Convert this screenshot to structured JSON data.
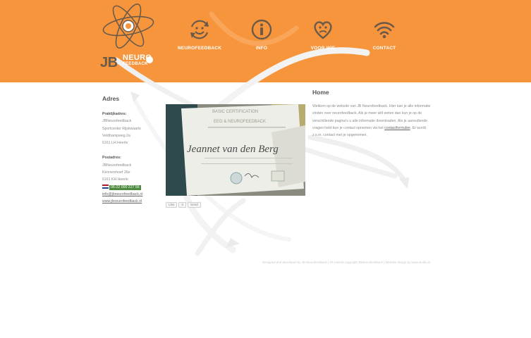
{
  "header": {
    "logo": {
      "text": "JB",
      "neuro": "NEURO",
      "feedback": "FEEDBACK"
    },
    "nav": [
      {
        "label": "NEUROFEEDBACK",
        "icon": "smiley-arrows-icon"
      },
      {
        "label": "INFO",
        "icon": "info-icon"
      },
      {
        "label": "VOOR WIE",
        "icon": "heart-face-icon"
      },
      {
        "label": "CONTACT",
        "icon": "wifi-icon"
      }
    ]
  },
  "left": {
    "title": "Adres",
    "praktijk_label": "Praktijkadres:",
    "praktijk": [
      "JBNeurofeedback",
      "Sportcenter Rijskwaarts",
      "Veldhampweg 2a",
      "6161 LH Heerle"
    ],
    "post_label": "Postadres:",
    "post": [
      "JBNeurofeedback",
      "Kennemhoef 26e",
      "6161 KH Heerle"
    ],
    "phone": "06-22 000 227 56",
    "email": "info@jbneurofeedback.nl",
    "website": "www.jbneurofeedback.nl"
  },
  "photo": {
    "badge_line1": "BASIC CERTIFICATION",
    "badge_line2": "EEG & NEUROFEEDBACK",
    "name": "Jeannet van den Berg"
  },
  "share": {
    "like": "Like",
    "count": "0",
    "send": "Send"
  },
  "main": {
    "title": "Home",
    "paragraph_before_link": "Welkom op de website van JB Neurofeedback. Hier kan je alle informatie vinden over neurofeedback. Als je meer wilt weten dan kun je op de verschillende pagina's u alle informatie downloaden. Als je aanvullende vragen hebt kun je contact opnemen via het ",
    "link_text": "contactformulier",
    "paragraph_after_link": ". Er wordt z.s.m. contact met je opgenomen."
  },
  "footer": {
    "text": "Designed and developed by JB Neurofeedback | All content copyright JBNeurofeedback | Website design by www.studio.nl"
  },
  "colors": {
    "header": "#f7953c",
    "brand_brown": "#6b5a4a",
    "phone_bg": "#4e8a3e"
  }
}
